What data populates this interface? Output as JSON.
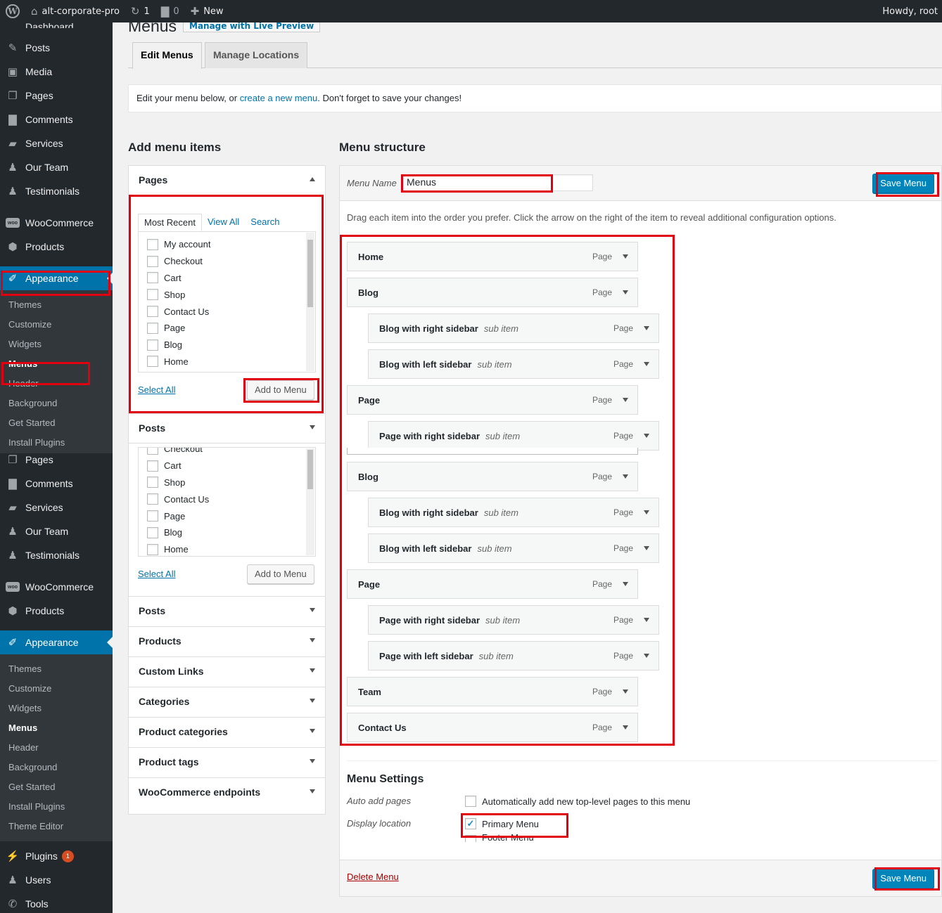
{
  "adminbar": {
    "site_name": "alt-corporate-pro",
    "updates_count": "1",
    "comments_count": "0",
    "new_label": "New",
    "howdy": "Howdy, root"
  },
  "sidebar": {
    "top_cut_label": "Dashboard",
    "group1": [
      {
        "label": "Posts",
        "icon": "pin-icon"
      },
      {
        "label": "Media",
        "icon": "media-icon"
      },
      {
        "label": "Pages",
        "icon": "pages-icon"
      },
      {
        "label": "Comments",
        "icon": "comments-icon"
      },
      {
        "label": "Services",
        "icon": "folder-icon"
      },
      {
        "label": "Our Team",
        "icon": "user-icon"
      },
      {
        "label": "Testimonials",
        "icon": "user-icon"
      }
    ],
    "woocommerce": "WooCommerce",
    "products": "Products",
    "appearance": "Appearance",
    "submenu1": [
      "Themes",
      "Customize",
      "Widgets",
      "Menus",
      "Header",
      "Background",
      "Get Started",
      "Install Plugins"
    ],
    "group2": [
      {
        "label": "Pages"
      },
      {
        "label": "Comments"
      },
      {
        "label": "Services"
      },
      {
        "label": "Our Team"
      },
      {
        "label": "Testimonials"
      }
    ],
    "submenu2": [
      "Themes",
      "Customize",
      "Widgets",
      "Menus",
      "Header",
      "Background",
      "Get Started",
      "Install Plugins",
      "Theme Editor"
    ],
    "plugins": "Plugins",
    "plugins_count": "1",
    "users": "Users",
    "tools": "Tools"
  },
  "page": {
    "title": "Menus",
    "live_preview": "Manage with Live Preview",
    "tab_edit": "Edit Menus",
    "tab_locations": "Manage Locations",
    "notice_pre": "Edit your menu below, or ",
    "notice_link": "create a new menu",
    "notice_post": ". Don't forget to save your changes!"
  },
  "add_items": {
    "title": "Add menu items",
    "pages_panel": {
      "title": "Pages",
      "tabs": [
        "Most Recent",
        "View All",
        "Search"
      ],
      "items": [
        "My account",
        "Checkout",
        "Cart",
        "Shop",
        "Contact Us",
        "Page",
        "Blog",
        "Home"
      ],
      "select_all": "Select All",
      "add_button": "Add to Menu"
    },
    "posts_panel": {
      "title": "Posts",
      "items": [
        "Checkout",
        "Cart",
        "Shop",
        "Contact Us",
        "Page",
        "Blog",
        "Home"
      ],
      "select_all": "Select All",
      "add_button": "Add to Menu"
    },
    "collapsed": [
      "Posts",
      "Products",
      "Custom Links",
      "Categories",
      "Product categories",
      "Product tags",
      "WooCommerce endpoints"
    ]
  },
  "structure": {
    "title": "Menu structure",
    "menu_name_label": "Menu Name",
    "menu_name_value": "Menus",
    "save_label": "Save Menu",
    "hint": "Drag each item into the order you prefer. Click the arrow on the right of the item to reveal additional configuration options.",
    "items": [
      {
        "title": "Home",
        "sub": "",
        "type": "Page",
        "depth": 0
      },
      {
        "title": "Blog",
        "sub": "",
        "type": "Page",
        "depth": 0
      },
      {
        "title": "Blog with right sidebar",
        "sub": "sub item",
        "type": "Page",
        "depth": 1
      },
      {
        "title": "Blog with left sidebar",
        "sub": "sub item",
        "type": "Page",
        "depth": 1
      },
      {
        "title": "Page",
        "sub": "",
        "type": "Page",
        "depth": 0
      },
      {
        "title": "Page with right sidebar",
        "sub": "sub item",
        "type": "Page",
        "depth": 1
      },
      {
        "title": "Blog",
        "sub": "",
        "type": "Page",
        "depth": 0
      },
      {
        "title": "Blog with right sidebar",
        "sub": "sub item",
        "type": "Page",
        "depth": 1
      },
      {
        "title": "Blog with left sidebar",
        "sub": "sub item",
        "type": "Page",
        "depth": 1
      },
      {
        "title": "Page",
        "sub": "",
        "type": "Page",
        "depth": 0
      },
      {
        "title": "Page with right sidebar",
        "sub": "sub item",
        "type": "Page",
        "depth": 1
      },
      {
        "title": "Page with left sidebar",
        "sub": "sub item",
        "type": "Page",
        "depth": 1
      },
      {
        "title": "Team",
        "sub": "",
        "type": "Page",
        "depth": 0
      },
      {
        "title": "Contact Us",
        "sub": "",
        "type": "Page",
        "depth": 0
      }
    ],
    "settings_title": "Menu Settings",
    "auto_add_label": "Auto add pages",
    "auto_add_text": "Automatically add new top-level pages to this menu",
    "display_label": "Display location",
    "primary_menu": "Primary Menu",
    "footer_menu": "Footer Menu",
    "delete_label": "Delete Menu"
  },
  "colors": {
    "highlight": "#e0000f",
    "primary": "#0085ba",
    "sidebar_bg": "#23282d",
    "current_item": "#0073aa"
  }
}
